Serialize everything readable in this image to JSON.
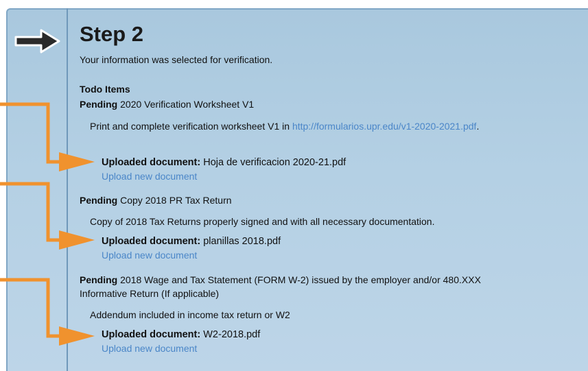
{
  "step": {
    "title": "Step 2",
    "subtitle": "Your information was selected for verification."
  },
  "todo_heading": "Todo Items",
  "items": [
    {
      "status": "Pending",
      "name": "2020 Verification Worksheet V1",
      "description_prefix": "Print and complete verification worksheet V1 in ",
      "description_link": "http://formularios.upr.edu/v1-2020-2021.pdf",
      "description_suffix": ".",
      "uploaded_label": "Uploaded document:",
      "uploaded_file": "Hoja de verificacion 2020-21.pdf",
      "upload_new": "Upload new document"
    },
    {
      "status": "Pending",
      "name": "Copy 2018 PR Tax Return",
      "description": "Copy of 2018 Tax Returns properly signed and with all necessary documentation.",
      "uploaded_label": "Uploaded document:",
      "uploaded_file": "planillas 2018.pdf",
      "upload_new": "Upload new document"
    },
    {
      "status": "Pending",
      "name": "2018 Wage and Tax Statement (FORM W-2) issued by the employer and/or 480.XXX Informative Return (If applicable)",
      "description": "Addendum included in income tax return or W2",
      "uploaded_label": "Uploaded document:",
      "uploaded_file": "W2-2018.pdf",
      "upload_new": "Upload new document"
    }
  ],
  "colors": {
    "link": "#4a86c8",
    "annotation_arrow": "#f0922e",
    "panel_bg": "#b4d0e4"
  },
  "icons": [
    "arrow-right-icon",
    "annotation-arrow-icon"
  ]
}
